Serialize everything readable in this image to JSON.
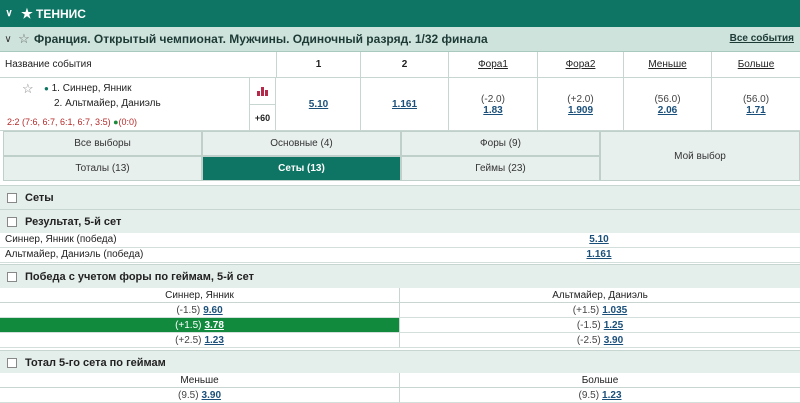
{
  "sport": {
    "title": "ТЕННИС"
  },
  "championship": {
    "title": "Франция. Открытый чемпионат. Мужчины. Одиночный разряд. 1/32 финала",
    "all_events": "Все события"
  },
  "columns": {
    "name": "Название события",
    "c1": "1",
    "c2": "2",
    "fora1": "Фора1",
    "fora2": "Фора2",
    "less": "Меньше",
    "more": "Больше"
  },
  "event": {
    "player1": "1. Синнер, Янник",
    "player2": "2. Альтмайер, Даниэль",
    "score": "2:2 (7:6, 6:7, 6:1, 6:7, 3:5)",
    "serve_score": "(0:0)",
    "more_count": "+60",
    "odds_1": "5.10",
    "odds_2": "1.161",
    "fora1_handicap": "(-2.0)",
    "fora1_odds": "1.83",
    "fora2_handicap": "(+2.0)",
    "fora2_odds": "1.909",
    "less_total": "(56.0)",
    "less_odds": "2.06",
    "more_total": "(56.0)",
    "more_odds": "1.71"
  },
  "tabs": {
    "all": "Все выборы",
    "main": "Основные (4)",
    "foras": "Форы (9)",
    "my": "Мой выбор",
    "totals": "Тоталы (13)",
    "sets": "Сеты (13)",
    "games": "Геймы (23)"
  },
  "sections": {
    "sets": "Сеты",
    "result": "Результат, 5-й сет",
    "handicap": "Победа с учетом форы по геймам, 5-й сет",
    "total": "Тотал 5-го сета по геймам"
  },
  "result_rows": [
    {
      "label": "Синнер, Янник (победа)",
      "odds": "5.10"
    },
    {
      "label": "Альтмайер, Даниэль (победа)",
      "odds": "1.161"
    }
  ],
  "handicap": {
    "left_header": "Синнер, Янник",
    "right_header": "Альтмайер, Даниэль",
    "rows": [
      {
        "lh": "(-1.5)",
        "lo": "9.60",
        "rh": "(+1.5)",
        "ro": "1.035"
      },
      {
        "lh": "(+1.5)",
        "lo": "3.78",
        "rh": "(-1.5)",
        "ro": "1.25"
      },
      {
        "lh": "(+2.5)",
        "lo": "1.23",
        "rh": "(-2.5)",
        "ro": "3.90"
      }
    ]
  },
  "total": {
    "left_header": "Меньше",
    "right_header": "Больше",
    "lh": "(9.5)",
    "lo": "3.90",
    "rh": "(9.5)",
    "ro": "1.23"
  },
  "colors": {
    "primary": "#0e7564",
    "highlight": "#128a3e",
    "score": "#b52a2a"
  }
}
